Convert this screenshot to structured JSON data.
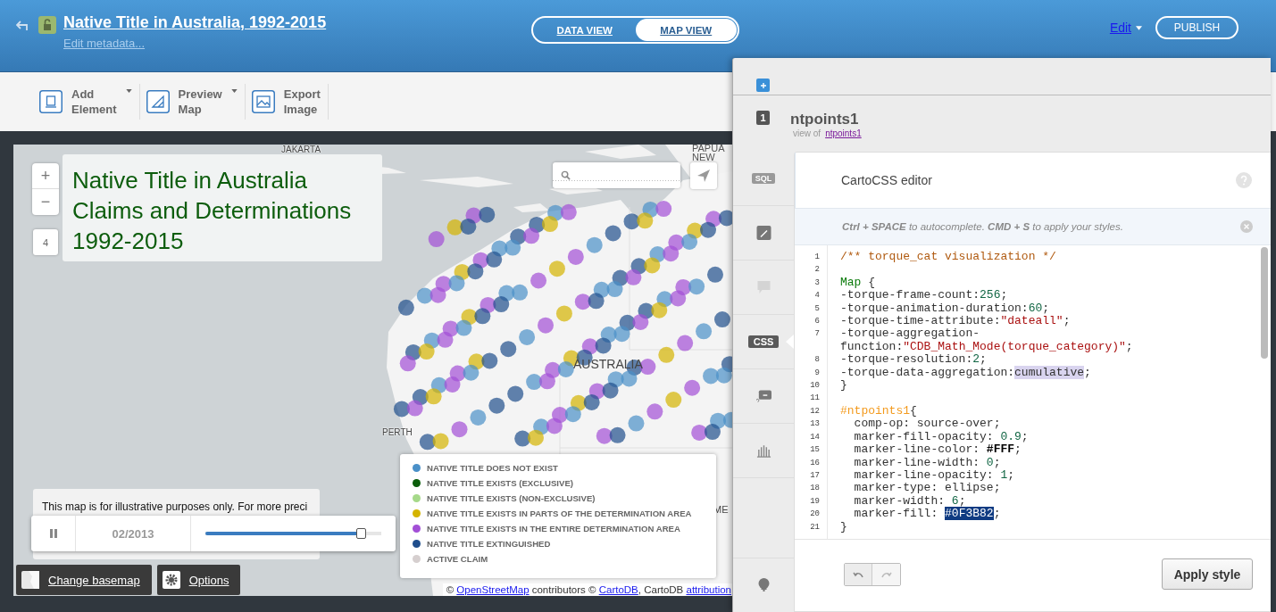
{
  "header": {
    "title": "Native Title in Australia, 1992-2015",
    "subtitle": "Edit metadata...",
    "views": [
      {
        "label": "DATA VIEW",
        "selected": false
      },
      {
        "label": "MAP VIEW",
        "selected": true
      }
    ],
    "edit": "Edit",
    "publish": "PUBLISH"
  },
  "toolbar": [
    {
      "kind": "element",
      "line1": "Add",
      "line2": "Element",
      "dropdown": true
    },
    {
      "kind": "preview",
      "line1": "Preview",
      "line2": "Map",
      "dropdown": true
    },
    {
      "kind": "export",
      "line1": "Export",
      "line2": "Image",
      "dropdown": false
    }
  ],
  "map": {
    "title_lines": [
      "Native Title in Australia",
      "Claims and Determinations",
      "1992-2015"
    ],
    "zoom_in": "+",
    "zoom_out": "−",
    "zoom_level": "4",
    "labels": [
      {
        "text": "JAKARTA",
        "kind": "city"
      },
      {
        "text": "PAPUA NEW",
        "kind": "region"
      },
      {
        "text": "AUSTRALIA",
        "kind": "region"
      },
      {
        "text": "PERTH",
        "kind": "city"
      },
      {
        "text": "ME",
        "kind": "region"
      }
    ],
    "disclaimer": "This map is for illustrative purposes only. For more preci",
    "timeline": {
      "date": "02/2013",
      "level": 0.89
    },
    "legend": [
      {
        "label": "NATIVE TITLE DOES NOT EXIST",
        "color": "#4a90c8"
      },
      {
        "label": "NATIVE TITLE EXISTS (EXCLUSIVE)",
        "color": "#0b5d0b"
      },
      {
        "label": "NATIVE TITLE EXISTS (NON-EXCLUSIVE)",
        "color": "#a6d98a"
      },
      {
        "label": "NATIVE TITLE EXISTS IN PARTS OF THE DETERMINATION AREA",
        "color": "#d4b400"
      },
      {
        "label": "NATIVE TITLE EXISTS IN THE ENTIRE DETERMINATION AREA",
        "color": "#a24fd6"
      },
      {
        "label": "NATIVE TITLE EXTINGUISHED",
        "color": "#1f4e8c"
      },
      {
        "label": "ACTIVE CLAIM",
        "color": "#d6cfcf"
      }
    ],
    "basemap_button": "Change basemap",
    "options_button": "Options",
    "attribution": [
      {
        "kind": "text",
        "text": "© "
      },
      {
        "kind": "link",
        "text": "OpenStreetMap"
      },
      {
        "kind": "text",
        "text": " contributors © "
      },
      {
        "kind": "link",
        "text": "CartoDB"
      },
      {
        "kind": "text",
        "text": ", CartoDB "
      },
      {
        "kind": "link",
        "text": "attribution"
      }
    ]
  },
  "panel": {
    "layer": {
      "number": "1",
      "name": "ntpoints1",
      "view_of": "view of",
      "source": "ntpoints1"
    },
    "tabs": [
      {
        "kind": "sql",
        "label": "SQL",
        "selected": false
      },
      {
        "kind": "wizard",
        "selected": false
      },
      {
        "kind": "infowindow",
        "selected": false
      },
      {
        "kind": "css",
        "label": "CSS",
        "selected": true
      },
      {
        "kind": "legend",
        "selected": false
      },
      {
        "kind": "chart",
        "selected": false
      },
      {
        "kind": "addlayer",
        "selected": false
      }
    ],
    "editor": {
      "title": "CartoCSS editor",
      "hint": "**Ctrl + SPACE** to autocomplete. **CMD + S** to apply your styles.",
      "apply": "Apply style",
      "lines": [
        {
          "number": "1",
          "tokens": [
            {
              "kind": "comment",
              "text": "/** torque_cat visualization */"
            }
          ]
        },
        {
          "number": "2"
        },
        {
          "number": "3",
          "tokens": [
            {
              "kind": "keyword",
              "text": "Map"
            },
            {
              "kind": "plain",
              "text": " {"
            }
          ]
        },
        {
          "number": "4",
          "tokens": [
            {
              "kind": "plain",
              "text": "-torque-frame-count:"
            },
            {
              "kind": "number",
              "text": "256"
            },
            {
              "kind": "plain",
              "text": ";"
            }
          ]
        },
        {
          "number": "5",
          "tokens": [
            {
              "kind": "plain",
              "text": "-torque-animation-duration:"
            },
            {
              "kind": "number",
              "text": "60"
            },
            {
              "kind": "plain",
              "text": ";"
            }
          ]
        },
        {
          "number": "6",
          "tokens": [
            {
              "kind": "plain",
              "text": "-torque-time-attribute:"
            },
            {
              "kind": "string",
              "text": "\"dateall\""
            },
            {
              "kind": "plain",
              "text": ";"
            }
          ]
        },
        {
          "number": "7",
          "tokens": [
            {
              "kind": "plain",
              "text": "-torque-aggregation-function:"
            },
            {
              "kind": "string",
              "text": "\"CDB_Math_Mode(torque_category)\""
            },
            {
              "kind": "plain",
              "text": ";"
            }
          ]
        },
        {
          "number": "8",
          "tokens": [
            {
              "kind": "plain",
              "text": "-torque-resolution:"
            },
            {
              "kind": "number",
              "text": "2"
            },
            {
              "kind": "plain",
              "text": ";"
            }
          ]
        },
        {
          "number": "9",
          "tokens": [
            {
              "kind": "plain",
              "text": "-torque-data-aggregation:"
            },
            {
              "kind": "highlight",
              "text": "cumulative"
            },
            {
              "kind": "plain",
              "text": ";"
            }
          ]
        },
        {
          "number": "10",
          "tokens": [
            {
              "kind": "plain",
              "text": "}"
            }
          ]
        },
        {
          "number": "11"
        },
        {
          "number": "12",
          "tokens": [
            {
              "kind": "selector",
              "text": "#ntpoints1"
            },
            {
              "kind": "plain",
              "text": "{"
            }
          ]
        },
        {
          "number": "13",
          "tokens": [
            {
              "kind": "plain",
              "text": "  comp-op: source-over;"
            }
          ]
        },
        {
          "number": "14",
          "tokens": [
            {
              "kind": "plain",
              "text": "  marker-fill-opacity: "
            },
            {
              "kind": "number",
              "text": "0.9"
            },
            {
              "kind": "plain",
              "text": ";"
            }
          ]
        },
        {
          "number": "15",
          "tokens": [
            {
              "kind": "plain",
              "text": "  marker-line-color: "
            },
            {
              "kind": "color",
              "text": "#FFF"
            },
            {
              "kind": "plain",
              "text": ";"
            }
          ]
        },
        {
          "number": "16",
          "tokens": [
            {
              "kind": "plain",
              "text": "  marker-line-width: "
            },
            {
              "kind": "number",
              "text": "0"
            },
            {
              "kind": "plain",
              "text": ";"
            }
          ]
        },
        {
          "number": "17",
          "tokens": [
            {
              "kind": "plain",
              "text": "  marker-line-opacity: "
            },
            {
              "kind": "number",
              "text": "1"
            },
            {
              "kind": "plain",
              "text": ";"
            }
          ]
        },
        {
          "number": "18",
          "tokens": [
            {
              "kind": "plain",
              "text": "  marker-type: ellipse;"
            }
          ]
        },
        {
          "number": "19",
          "tokens": [
            {
              "kind": "plain",
              "text": "  marker-width: "
            },
            {
              "kind": "number",
              "text": "6"
            },
            {
              "kind": "plain",
              "text": ";"
            }
          ]
        },
        {
          "number": "20",
          "tokens": [
            {
              "kind": "plain",
              "text": "  marker-fill: "
            },
            {
              "kind": "selection",
              "text": "#0F3B82"
            },
            {
              "kind": "plain",
              "text": ";"
            }
          ]
        },
        {
          "number": "21",
          "tokens": [
            {
              "kind": "plain",
              "text": "}"
            }
          ]
        }
      ]
    }
  }
}
